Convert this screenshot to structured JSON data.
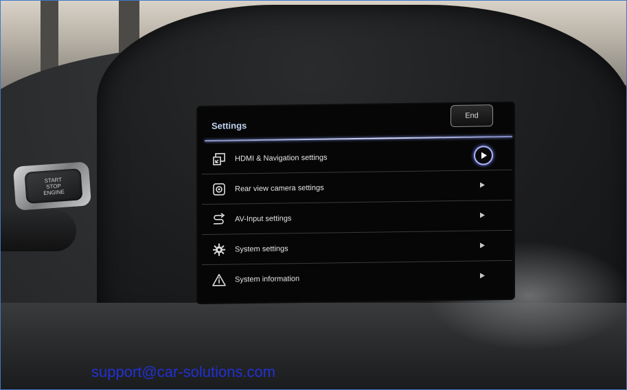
{
  "console": {
    "start_button": [
      "START",
      "STOP",
      "ENGINE"
    ]
  },
  "screen": {
    "title": "Settings",
    "end_label": "End",
    "items": [
      {
        "label": "HDMI & Navigation settings",
        "icon": "hdmi-icon",
        "selected": true
      },
      {
        "label": "Rear view camera settings",
        "icon": "camera-icon",
        "selected": false
      },
      {
        "label": "AV-Input settings",
        "icon": "av-input-icon",
        "selected": false
      },
      {
        "label": "System settings",
        "icon": "gear-icon",
        "selected": false
      },
      {
        "label": "System information",
        "icon": "warning-info-icon",
        "selected": false
      }
    ],
    "accent": "#aab3ff"
  },
  "watermark": {
    "text": "support@car-solutions.com",
    "color": "#2233e6"
  }
}
